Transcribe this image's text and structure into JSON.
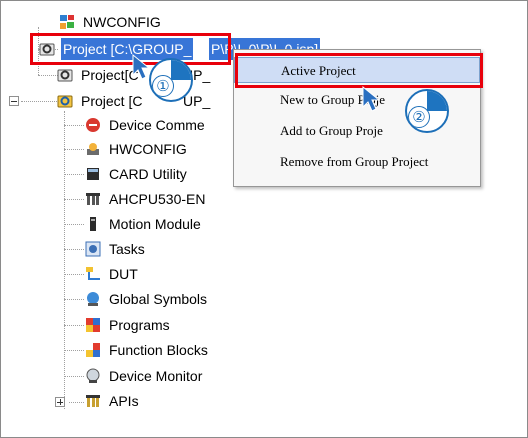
{
  "tree": {
    "root_label": "NWCONFIG",
    "project1_label": "Project [C:\\GROUP_",
    "project1_trailing": "P\\P\\L 0\\P\\L 0.isp]",
    "project2_label": "Project[C",
    "project2_tail": "UP_",
    "project3_label": "Project [C",
    "project3_tail": "UP_",
    "children": [
      {
        "label": "Device Comme",
        "icon": "device-comment-icon"
      },
      {
        "label": "HWCONFIG",
        "icon": "hwconfig-icon"
      },
      {
        "label": "CARD Utility",
        "icon": "card-utility-icon"
      },
      {
        "label": "AHCPU530-EN",
        "icon": "cpu-icon"
      },
      {
        "label": "Motion Module",
        "icon": "motion-module-icon"
      },
      {
        "label": "Tasks",
        "icon": "tasks-icon"
      },
      {
        "label": "DUT",
        "icon": "dut-icon"
      },
      {
        "label": "Global Symbols",
        "icon": "global-symbols-icon"
      },
      {
        "label": "Programs",
        "icon": "programs-icon"
      },
      {
        "label": "Function Blocks",
        "icon": "function-blocks-icon"
      },
      {
        "label": "Device Monitor",
        "icon": "device-monitor-icon"
      },
      {
        "label": "APIs",
        "icon": "apis-icon"
      }
    ]
  },
  "context_menu": {
    "items": [
      "Active Project",
      "New to Group Proje",
      "Add to Group Proje",
      "Remove from Group Project"
    ]
  },
  "callouts": {
    "first": "①",
    "second": "②"
  },
  "colors": {
    "highlight": "#cfddf5",
    "selection": "#3875d7",
    "annotation_red": "#e8000b",
    "callout_blue": "#1e74c0"
  }
}
